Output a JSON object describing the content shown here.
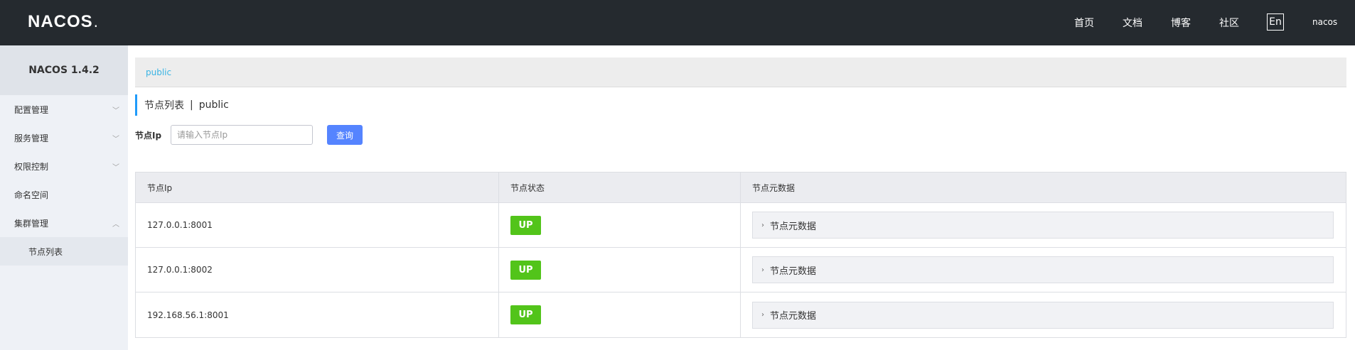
{
  "header": {
    "logo": "NACOS",
    "logo_suffix": ".",
    "nav": [
      "首页",
      "文档",
      "博客",
      "社区"
    ],
    "lang": "En",
    "user": "nacos"
  },
  "sidebar": {
    "title": "NACOS 1.4.2",
    "items": [
      {
        "label": "配置管理",
        "expanded": false
      },
      {
        "label": "服务管理",
        "expanded": false
      },
      {
        "label": "权限控制",
        "expanded": false
      },
      {
        "label": "命名空间"
      },
      {
        "label": "集群管理",
        "expanded": true
      }
    ],
    "subitems": [
      {
        "label": "节点列表"
      }
    ]
  },
  "main": {
    "namespace": "public",
    "title": "节点列表",
    "title_sep": "|",
    "title_ns": "public",
    "search": {
      "label": "节点Ip",
      "placeholder": "请输入节点Ip",
      "button": "查询"
    },
    "table": {
      "columns": [
        "节点Ip",
        "节点状态",
        "节点元数据"
      ],
      "rows": [
        {
          "ip": "127.0.0.1:8001",
          "state": "UP",
          "meta": "节点元数据"
        },
        {
          "ip": "127.0.0.1:8002",
          "state": "UP",
          "meta": "节点元数据"
        },
        {
          "ip": "192.168.56.1:8001",
          "state": "UP",
          "meta": "节点元数据"
        }
      ]
    }
  },
  "colors": {
    "header_bg": "#252a2f",
    "primary": "#5584ff",
    "status_up": "#52c41a",
    "link": "#39b4e4"
  }
}
